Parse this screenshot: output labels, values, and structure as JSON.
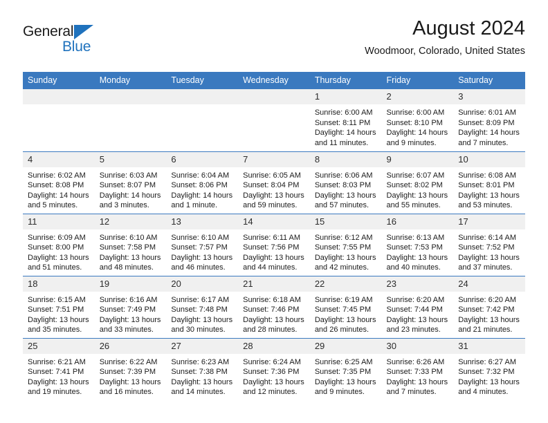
{
  "brand": {
    "name_part1": "General",
    "name_part2": "Blue",
    "triangle_color": "#1f72bd"
  },
  "header": {
    "title": "August 2024",
    "subtitle": "Woodmoor, Colorado, United States",
    "accent_color": "#3a79bf",
    "header_text_color": "#ffffff",
    "daynum_band_color": "#f0f0f0"
  },
  "weekdays": [
    "Sunday",
    "Monday",
    "Tuesday",
    "Wednesday",
    "Thursday",
    "Friday",
    "Saturday"
  ],
  "weeks": [
    [
      {
        "day": "",
        "empty": true
      },
      {
        "day": "",
        "empty": true
      },
      {
        "day": "",
        "empty": true
      },
      {
        "day": "",
        "empty": true
      },
      {
        "day": "1",
        "sunrise": "Sunrise: 6:00 AM",
        "sunset": "Sunset: 8:11 PM",
        "daylight": "Daylight: 14 hours and 11 minutes."
      },
      {
        "day": "2",
        "sunrise": "Sunrise: 6:00 AM",
        "sunset": "Sunset: 8:10 PM",
        "daylight": "Daylight: 14 hours and 9 minutes."
      },
      {
        "day": "3",
        "sunrise": "Sunrise: 6:01 AM",
        "sunset": "Sunset: 8:09 PM",
        "daylight": "Daylight: 14 hours and 7 minutes."
      }
    ],
    [
      {
        "day": "4",
        "sunrise": "Sunrise: 6:02 AM",
        "sunset": "Sunset: 8:08 PM",
        "daylight": "Daylight: 14 hours and 5 minutes."
      },
      {
        "day": "5",
        "sunrise": "Sunrise: 6:03 AM",
        "sunset": "Sunset: 8:07 PM",
        "daylight": "Daylight: 14 hours and 3 minutes."
      },
      {
        "day": "6",
        "sunrise": "Sunrise: 6:04 AM",
        "sunset": "Sunset: 8:06 PM",
        "daylight": "Daylight: 14 hours and 1 minute."
      },
      {
        "day": "7",
        "sunrise": "Sunrise: 6:05 AM",
        "sunset": "Sunset: 8:04 PM",
        "daylight": "Daylight: 13 hours and 59 minutes."
      },
      {
        "day": "8",
        "sunrise": "Sunrise: 6:06 AM",
        "sunset": "Sunset: 8:03 PM",
        "daylight": "Daylight: 13 hours and 57 minutes."
      },
      {
        "day": "9",
        "sunrise": "Sunrise: 6:07 AM",
        "sunset": "Sunset: 8:02 PM",
        "daylight": "Daylight: 13 hours and 55 minutes."
      },
      {
        "day": "10",
        "sunrise": "Sunrise: 6:08 AM",
        "sunset": "Sunset: 8:01 PM",
        "daylight": "Daylight: 13 hours and 53 minutes."
      }
    ],
    [
      {
        "day": "11",
        "sunrise": "Sunrise: 6:09 AM",
        "sunset": "Sunset: 8:00 PM",
        "daylight": "Daylight: 13 hours and 51 minutes."
      },
      {
        "day": "12",
        "sunrise": "Sunrise: 6:10 AM",
        "sunset": "Sunset: 7:58 PM",
        "daylight": "Daylight: 13 hours and 48 minutes."
      },
      {
        "day": "13",
        "sunrise": "Sunrise: 6:10 AM",
        "sunset": "Sunset: 7:57 PM",
        "daylight": "Daylight: 13 hours and 46 minutes."
      },
      {
        "day": "14",
        "sunrise": "Sunrise: 6:11 AM",
        "sunset": "Sunset: 7:56 PM",
        "daylight": "Daylight: 13 hours and 44 minutes."
      },
      {
        "day": "15",
        "sunrise": "Sunrise: 6:12 AM",
        "sunset": "Sunset: 7:55 PM",
        "daylight": "Daylight: 13 hours and 42 minutes."
      },
      {
        "day": "16",
        "sunrise": "Sunrise: 6:13 AM",
        "sunset": "Sunset: 7:53 PM",
        "daylight": "Daylight: 13 hours and 40 minutes."
      },
      {
        "day": "17",
        "sunrise": "Sunrise: 6:14 AM",
        "sunset": "Sunset: 7:52 PM",
        "daylight": "Daylight: 13 hours and 37 minutes."
      }
    ],
    [
      {
        "day": "18",
        "sunrise": "Sunrise: 6:15 AM",
        "sunset": "Sunset: 7:51 PM",
        "daylight": "Daylight: 13 hours and 35 minutes."
      },
      {
        "day": "19",
        "sunrise": "Sunrise: 6:16 AM",
        "sunset": "Sunset: 7:49 PM",
        "daylight": "Daylight: 13 hours and 33 minutes."
      },
      {
        "day": "20",
        "sunrise": "Sunrise: 6:17 AM",
        "sunset": "Sunset: 7:48 PM",
        "daylight": "Daylight: 13 hours and 30 minutes."
      },
      {
        "day": "21",
        "sunrise": "Sunrise: 6:18 AM",
        "sunset": "Sunset: 7:46 PM",
        "daylight": "Daylight: 13 hours and 28 minutes."
      },
      {
        "day": "22",
        "sunrise": "Sunrise: 6:19 AM",
        "sunset": "Sunset: 7:45 PM",
        "daylight": "Daylight: 13 hours and 26 minutes."
      },
      {
        "day": "23",
        "sunrise": "Sunrise: 6:20 AM",
        "sunset": "Sunset: 7:44 PM",
        "daylight": "Daylight: 13 hours and 23 minutes."
      },
      {
        "day": "24",
        "sunrise": "Sunrise: 6:20 AM",
        "sunset": "Sunset: 7:42 PM",
        "daylight": "Daylight: 13 hours and 21 minutes."
      }
    ],
    [
      {
        "day": "25",
        "sunrise": "Sunrise: 6:21 AM",
        "sunset": "Sunset: 7:41 PM",
        "daylight": "Daylight: 13 hours and 19 minutes."
      },
      {
        "day": "26",
        "sunrise": "Sunrise: 6:22 AM",
        "sunset": "Sunset: 7:39 PM",
        "daylight": "Daylight: 13 hours and 16 minutes."
      },
      {
        "day": "27",
        "sunrise": "Sunrise: 6:23 AM",
        "sunset": "Sunset: 7:38 PM",
        "daylight": "Daylight: 13 hours and 14 minutes."
      },
      {
        "day": "28",
        "sunrise": "Sunrise: 6:24 AM",
        "sunset": "Sunset: 7:36 PM",
        "daylight": "Daylight: 13 hours and 12 minutes."
      },
      {
        "day": "29",
        "sunrise": "Sunrise: 6:25 AM",
        "sunset": "Sunset: 7:35 PM",
        "daylight": "Daylight: 13 hours and 9 minutes."
      },
      {
        "day": "30",
        "sunrise": "Sunrise: 6:26 AM",
        "sunset": "Sunset: 7:33 PM",
        "daylight": "Daylight: 13 hours and 7 minutes."
      },
      {
        "day": "31",
        "sunrise": "Sunrise: 6:27 AM",
        "sunset": "Sunset: 7:32 PM",
        "daylight": "Daylight: 13 hours and 4 minutes."
      }
    ]
  ]
}
